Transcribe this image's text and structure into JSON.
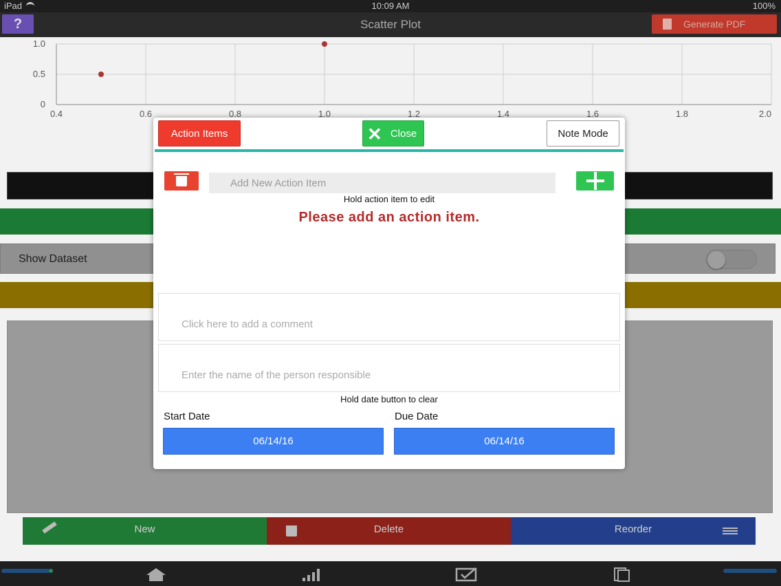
{
  "status_bar": {
    "carrier": "iPad",
    "time": "10:09 AM",
    "battery": "100%"
  },
  "nav": {
    "help_label": "?",
    "title": "Scatter Plot",
    "pdf_label": "Generate PDF"
  },
  "chart_data": {
    "type": "scatter",
    "x": [
      0.5,
      1.0
    ],
    "y": [
      0.5,
      1.0
    ],
    "xlim": [
      0.4,
      2.0
    ],
    "ylim": [
      0,
      1.0
    ],
    "x_ticks": [
      "0.4",
      "0.6",
      "0.8",
      "1.0",
      "1.2",
      "1.4",
      "1.6",
      "1.8",
      "2.0"
    ],
    "y_ticks": [
      "0",
      "0.5",
      "1.0"
    ],
    "grid": true,
    "point_color": "#a33"
  },
  "background": {
    "show_dataset_label": "Show Dataset",
    "buttons": {
      "new": "New",
      "delete": "Delete",
      "reorder": "Reorder"
    }
  },
  "tabs": [
    "home-icon",
    "bar-chart-icon",
    "checklist-icon",
    "documents-icon"
  ],
  "modal": {
    "action_items_label": "Action Items",
    "close_label": "Close",
    "note_mode_label": "Note Mode",
    "add_placeholder": "Add New Action Item",
    "hold_edit_hint": "Hold action item to edit",
    "empty_message": "Please add an action item.",
    "comment_placeholder": "Click here to add a comment",
    "person_placeholder": "Enter the name of the person responsible",
    "hold_date_hint": "Hold date button to clear",
    "start_date_label": "Start Date",
    "due_date_label": "Due Date",
    "start_date_value": "06/14/16",
    "due_date_value": "06/14/16"
  },
  "colors": {
    "danger": "#ef3a2e",
    "success": "#2fc553",
    "primary": "#3b7ff2",
    "accent_line": "#2ab5a9"
  }
}
